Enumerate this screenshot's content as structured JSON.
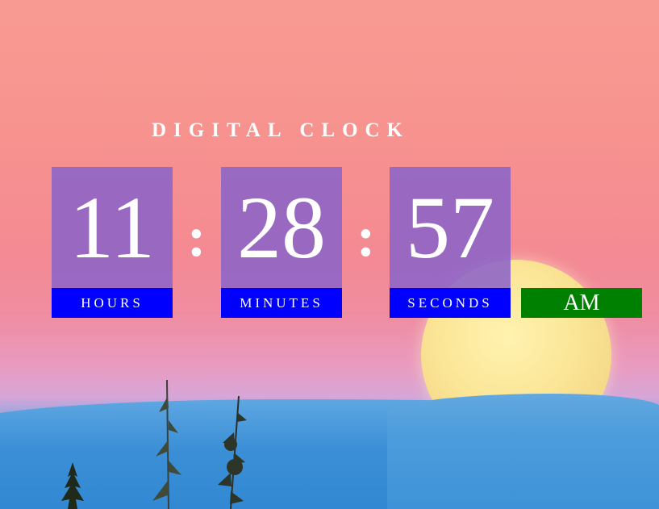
{
  "clock": {
    "title": "DIGITAL CLOCK",
    "hours": "11",
    "minutes": "28",
    "seconds": "57",
    "separator": ":",
    "hours_label": "HOURS",
    "minutes_label": "MINUTES",
    "seconds_label": "SECONDS",
    "period": "AM"
  },
  "colors": {
    "digit_box": "#8c64c8",
    "label_bar": "#0000ff",
    "period_bar": "#008000",
    "text": "#ffffff"
  },
  "icons": [
    "full-moon-image",
    "pine-tree-silhouette"
  ]
}
